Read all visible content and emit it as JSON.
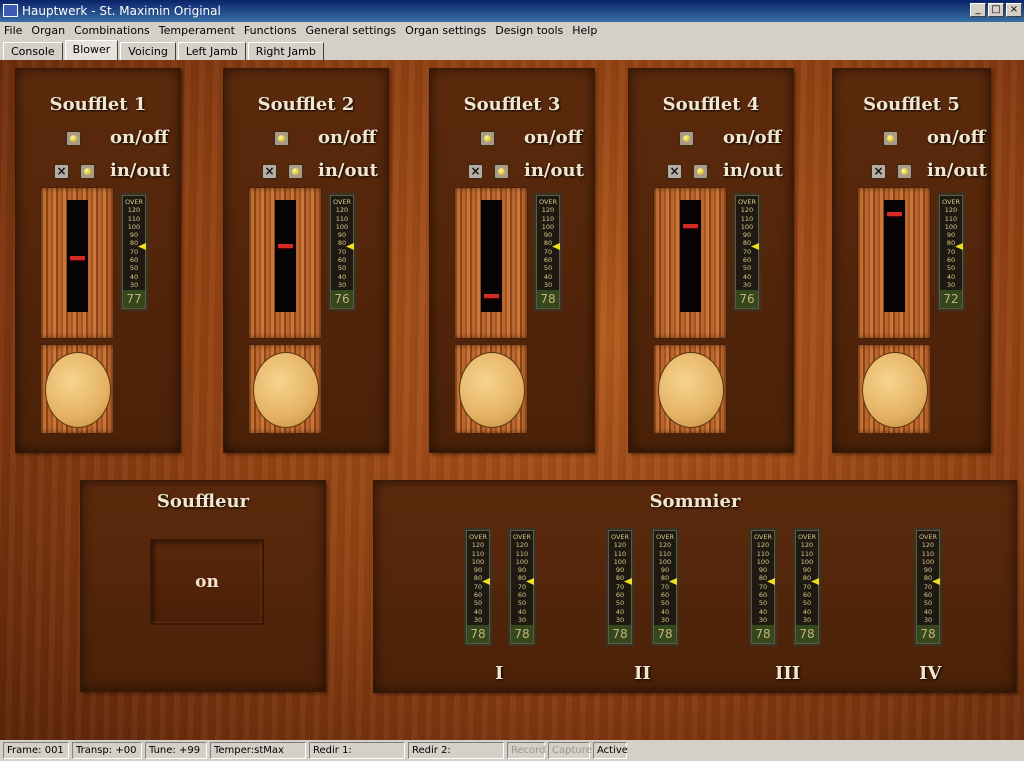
{
  "window": {
    "title": "Hauptwerk - St. Maximin Original"
  },
  "menu": [
    "File",
    "Organ",
    "Combinations",
    "Temperament",
    "Functions",
    "General settings",
    "Organ settings",
    "Design tools",
    "Help"
  ],
  "tabs": [
    "Console",
    "Blower",
    "Voicing",
    "Left Jamb",
    "Right Jamb"
  ],
  "active_tab": "Blower",
  "onoff_label": "on/off",
  "inout_label": "in/out",
  "gauge_scale": [
    "OVER",
    "120",
    "110",
    "100",
    "90",
    "80",
    "70",
    "60",
    "50",
    "40",
    "30"
  ],
  "soufflets": [
    {
      "title": "Soufflet 1",
      "value": "77"
    },
    {
      "title": "Soufflet 2",
      "value": "76"
    },
    {
      "title": "Soufflet 3",
      "value": "78"
    },
    {
      "title": "Soufflet 4",
      "value": "76"
    },
    {
      "title": "Soufflet 5",
      "value": "72"
    }
  ],
  "souffleur": {
    "title": "Souffleur",
    "button": "on"
  },
  "sommier": {
    "title": "Sommier",
    "gauges": [
      "78",
      "78",
      "78",
      "78",
      "78",
      "78",
      "78"
    ],
    "divisions": [
      "I",
      "II",
      "III",
      "IV"
    ]
  },
  "status": {
    "frame": "Frame: 001",
    "transp": "Transp: +00",
    "tune": "Tune: +99",
    "temper": "Temper:stMax",
    "redir1": "Redir 1:",
    "redir2": "Redir 2:",
    "record": "Record",
    "capture": "Capture",
    "active": "Active"
  }
}
